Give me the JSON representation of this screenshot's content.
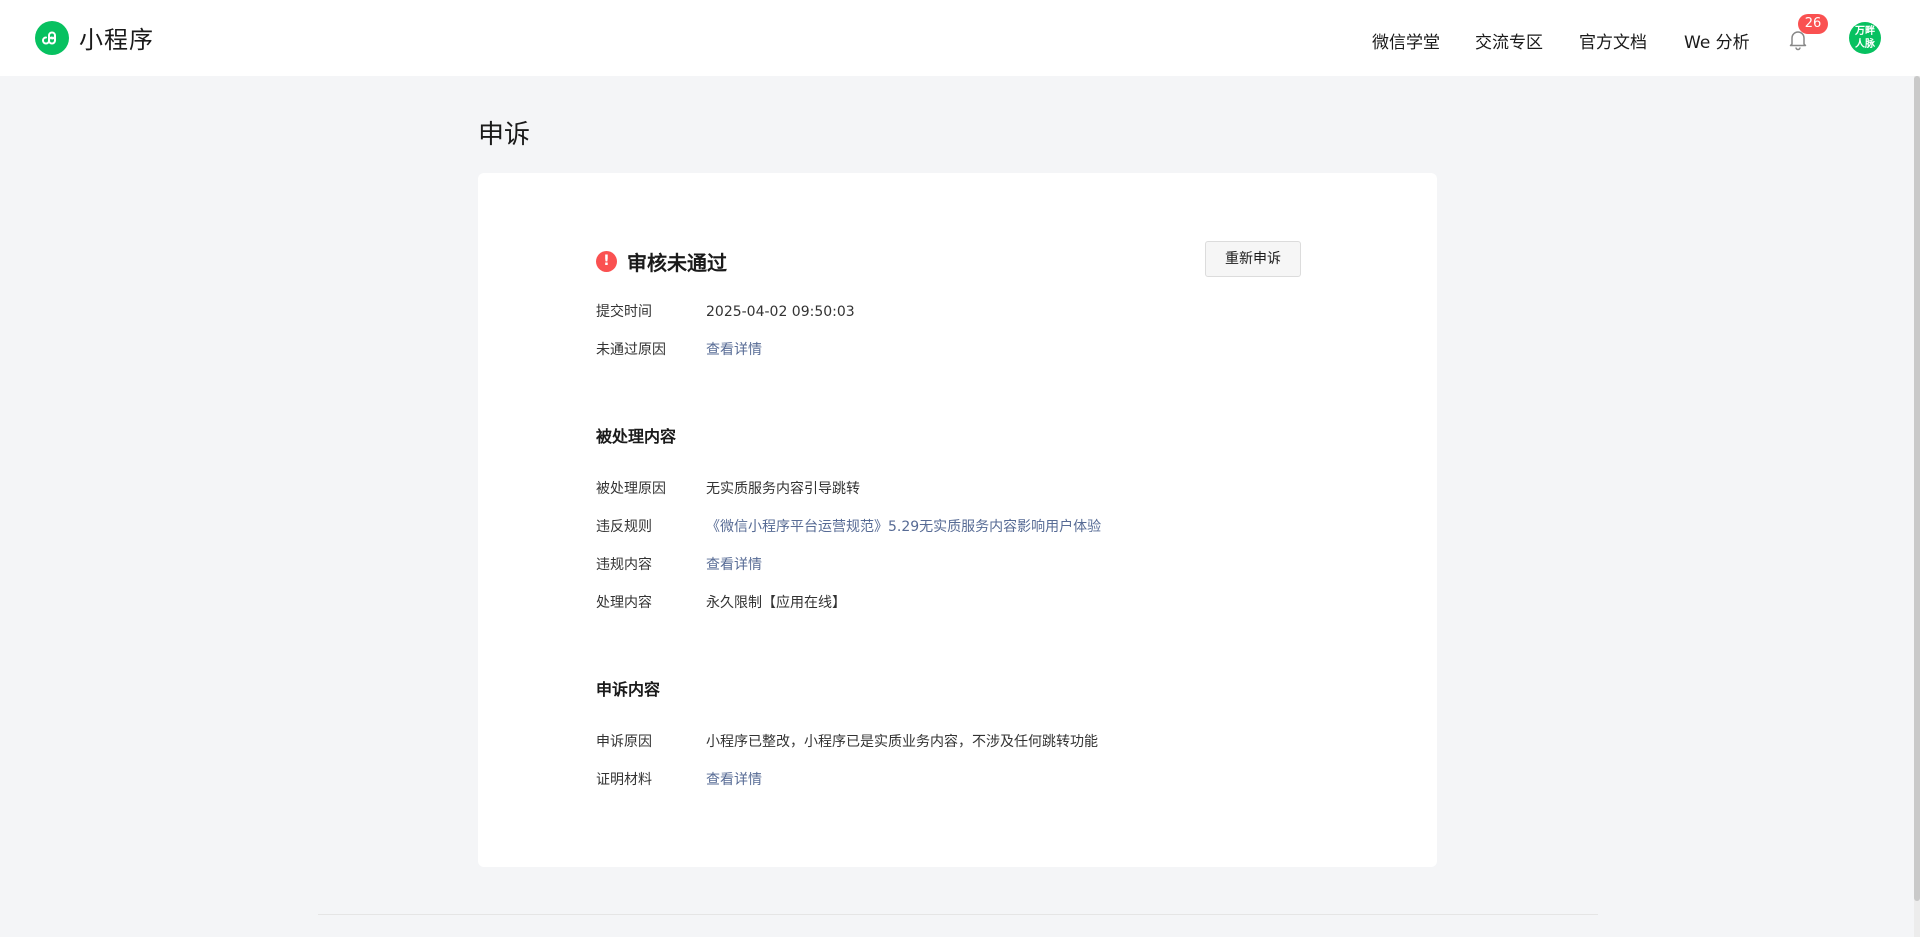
{
  "header": {
    "brand": "小程序",
    "nav": [
      "微信学堂",
      "交流专区",
      "官方文档",
      "We 分析"
    ],
    "notification_count": "26",
    "avatar_text_line1": "万畔",
    "avatar_text_line2": "人脉"
  },
  "page": {
    "title": "申诉"
  },
  "status": {
    "title": "审核未通过",
    "reappeal_label": "重新申诉",
    "submit_time_label": "提交时间",
    "submit_time_value": "2025-04-02 09:50:03",
    "reject_reason_label": "未通过原因",
    "reject_reason_link": "查看详情"
  },
  "processed": {
    "section_title": "被处理内容",
    "reason_label": "被处理原因",
    "reason_value": "无实质服务内容引导跳转",
    "rule_label": "违反规则",
    "rule_value": "《微信小程序平台运营规范》5.29无实质服务内容影响用户体验",
    "violation_label": "违规内容",
    "violation_link": "查看详情",
    "action_label": "处理内容",
    "action_value": "永久限制【应用在线】"
  },
  "appeal": {
    "section_title": "申诉内容",
    "reason_label": "申诉原因",
    "reason_value": "小程序已整改，小程序已是实质业务内容，不涉及任何跳转功能",
    "evidence_label": "证明材料",
    "evidence_link": "查看详情"
  },
  "colors": {
    "brand_green": "#07c160",
    "error_red": "#fa5151",
    "link_blue": "#576b95"
  }
}
